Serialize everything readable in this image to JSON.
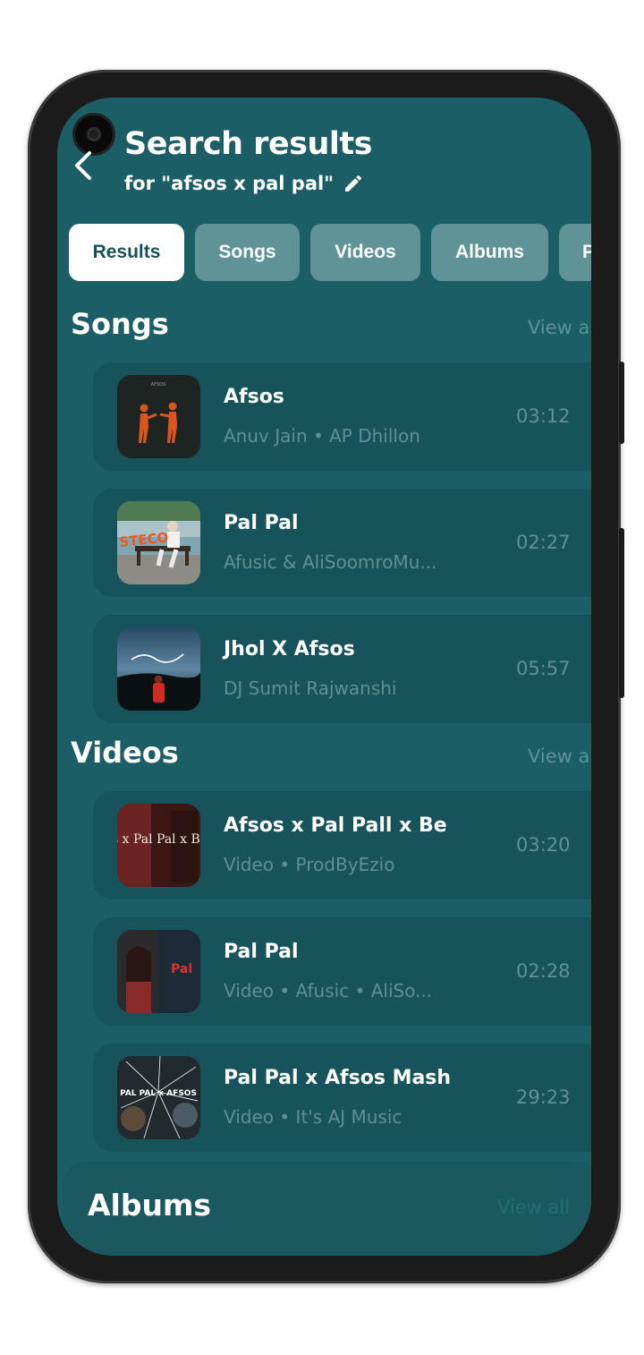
{
  "header": {
    "title": "Search results",
    "subtitle": "for \"afsos x pal pal\""
  },
  "tabs": [
    {
      "label": "Results",
      "active": true
    },
    {
      "label": "Songs",
      "active": false
    },
    {
      "label": "Videos",
      "active": false
    },
    {
      "label": "Albums",
      "active": false
    },
    {
      "label": "P",
      "active": false
    }
  ],
  "songs": {
    "title": "Songs",
    "view_all": "View a",
    "items": [
      {
        "title": "Afsos",
        "subtitle": "Anuv Jain • AP Dhillon",
        "duration": "03:12"
      },
      {
        "title": "Pal Pal",
        "subtitle": "Afusic & AliSoomroMu...",
        "duration": "02:27"
      },
      {
        "title": "Jhol X Afsos",
        "subtitle": "DJ Sumit Rajwanshi",
        "duration": "05:57"
      }
    ]
  },
  "videos": {
    "title": "Videos",
    "view_all": "View a",
    "items": [
      {
        "title": "Afsos x Pal Pall x Be",
        "subtitle": "Video • ProdByEzio",
        "duration": "03:20"
      },
      {
        "title": "Pal Pal",
        "subtitle": "Video • Afusic • AliSo...",
        "duration": "02:28"
      },
      {
        "title": "Pal Pal x Afsos Mash",
        "subtitle": "Video • It's AJ Music",
        "duration": "29:23"
      }
    ]
  },
  "albums": {
    "title": "Albums",
    "view_all": "View all"
  },
  "thumb_texts": {
    "afsos_cover": "AFSOS",
    "pal_pal_cover": "STECO",
    "video1_cover": "s x Pal Pal x Bee",
    "video2_cover": "Pal",
    "video3_cover": "PAL PAL x AFSOS"
  },
  "colors": {
    "background": "#1c5e66",
    "card": "#16535b",
    "chip": "#5f9398",
    "chip_active_text": "#15525a",
    "muted_text": "#5e8f94"
  }
}
